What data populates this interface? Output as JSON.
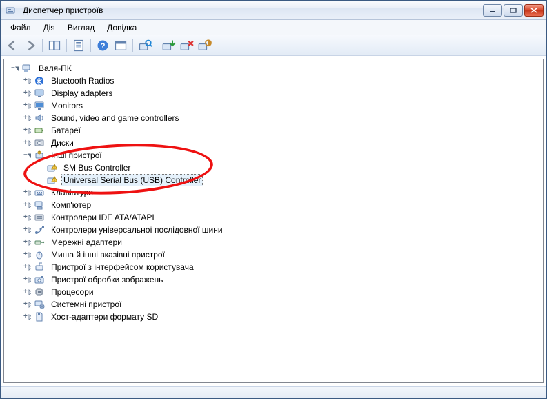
{
  "window": {
    "title": "Диспетчер пристроїв"
  },
  "menu": {
    "file": "Файл",
    "action": "Дія",
    "view": "Вигляд",
    "help": "Довідка"
  },
  "tree": {
    "root": "Валя-ПК",
    "items": [
      {
        "label": "Bluetooth Radios",
        "icon": "bluetooth"
      },
      {
        "label": "Display adapters",
        "icon": "display"
      },
      {
        "label": "Monitors",
        "icon": "monitor"
      },
      {
        "label": "Sound, video and game controllers",
        "icon": "sound"
      },
      {
        "label": "Батареї",
        "icon": "battery"
      },
      {
        "label": "Диски",
        "icon": "disk"
      },
      {
        "label": "Інші пристрої",
        "icon": "other",
        "expanded": true,
        "children": [
          {
            "label": "SM Bus Controller",
            "icon": "warn"
          },
          {
            "label": "Universal Serial Bus (USB) Controller",
            "icon": "warn",
            "selected": true
          }
        ]
      },
      {
        "label": "Клавіатури",
        "icon": "keyboard"
      },
      {
        "label": "Комп'ютер",
        "icon": "computer"
      },
      {
        "label": "Контролери IDE ATA/ATAPI",
        "icon": "ide"
      },
      {
        "label": "Контролери універсальної послідовної шини",
        "icon": "usb"
      },
      {
        "label": "Мережні адаптери",
        "icon": "network"
      },
      {
        "label": "Миша й інші вказівні пристрої",
        "icon": "mouse"
      },
      {
        "label": "Пристрої з інтерфейсом користувача",
        "icon": "hid"
      },
      {
        "label": "Пристрої обробки зображень",
        "icon": "imaging"
      },
      {
        "label": "Процесори",
        "icon": "cpu"
      },
      {
        "label": "Системні пристрої",
        "icon": "system"
      },
      {
        "label": "Хост-адаптери формату SD",
        "icon": "sd"
      }
    ]
  }
}
